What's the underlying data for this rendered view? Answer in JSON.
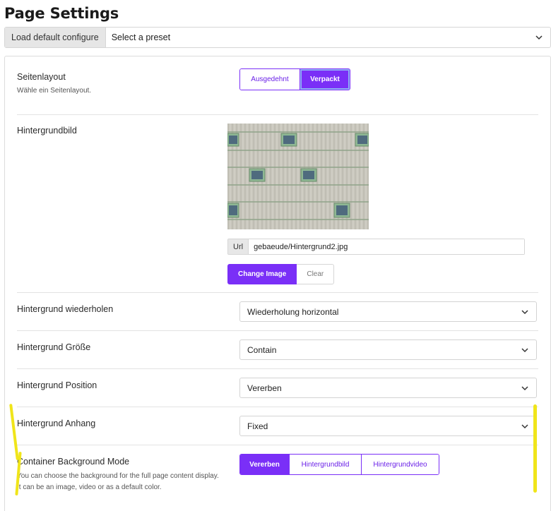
{
  "page": {
    "title": "Page Settings"
  },
  "preset": {
    "load_button": "Load default configure",
    "select_value": "Select a preset"
  },
  "layout": {
    "label": "Seitenlayout",
    "description": "Wähle ein Seitenlayout.",
    "options": [
      "Ausgedehnt",
      "Verpackt"
    ],
    "selected": "Verpackt"
  },
  "background_image": {
    "label": "Hintergrundbild",
    "url_addon": "Url",
    "url_value": "gebaeude/Hintergrund2.jpg",
    "change_button": "Change Image",
    "clear_button": "Clear"
  },
  "repeat": {
    "label": "Hintergrund wiederholen",
    "value": "Wiederholung horizontal"
  },
  "size": {
    "label": "Hintergrund Größe",
    "value": "Contain"
  },
  "position": {
    "label": "Hintergrund Position",
    "value": "Vererben"
  },
  "attachment": {
    "label": "Hintergrund Anhang",
    "value": "Fixed"
  },
  "container_mode": {
    "label": "Container Background Mode",
    "description": "You can choose the background for the full page content display. It can be an image, video or as a default color.",
    "options": [
      "Vererben",
      "Hintergrundbild",
      "Hintergrundvideo"
    ],
    "selected": "Vererben"
  },
  "colors": {
    "accent": "#7a2ff7",
    "highlighter": "#f0e51a"
  },
  "icons": {
    "select_caret": "chevron-down-icon"
  }
}
